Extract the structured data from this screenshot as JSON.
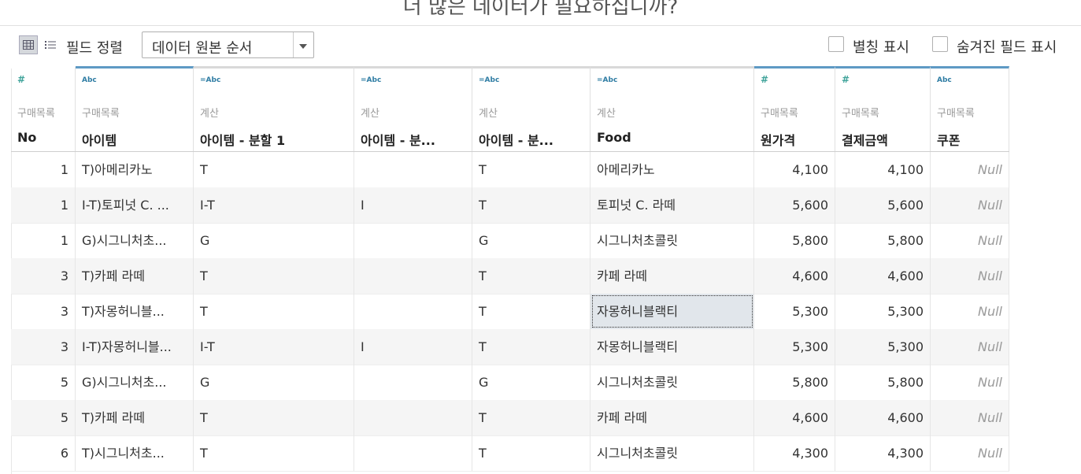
{
  "banner": {
    "text": "더 많은 데이터가 필요하십니까?"
  },
  "toolbar": {
    "grid_view_icon": "grid-icon",
    "list_view_icon": "list-icon",
    "sort_label": "필드 정렬",
    "sort_select": {
      "value": "데이터 원본 순서"
    },
    "show_aliases_label": "별칭 표시",
    "show_hidden_label": "숨겨진 필드 표시"
  },
  "columns": [
    {
      "type_icon": "#",
      "source": "구매목록",
      "name": "No"
    },
    {
      "type_icon": "Abc",
      "source": "구매목록",
      "name": "아이템"
    },
    {
      "type_icon": "=Abc",
      "source": "계산",
      "name": "아이템 - 분할 1"
    },
    {
      "type_icon": "=Abc",
      "source": "계산",
      "name": "아이템 - 분..."
    },
    {
      "type_icon": "=Abc",
      "source": "계산",
      "name": "아이템 - 분..."
    },
    {
      "type_icon": "=Abc",
      "source": "계산",
      "name": "Food"
    },
    {
      "type_icon": "#",
      "source": "구매목록",
      "name": "원가격"
    },
    {
      "type_icon": "#",
      "source": "구매목록",
      "name": "결제금액"
    },
    {
      "type_icon": "Abc",
      "source": "구매목록",
      "name": "쿠폰"
    }
  ],
  "rows": [
    [
      "1",
      "T)아메리카노",
      "T",
      "",
      "T",
      "아메리카노",
      "4,100",
      "4,100",
      "Null"
    ],
    [
      "1",
      "I-T)토피넛 C. ...",
      "I-T",
      "I",
      "T",
      "토피넛 C. 라떼",
      "5,600",
      "5,600",
      "Null"
    ],
    [
      "1",
      "G)시그니처초...",
      "G",
      "",
      "G",
      "시그니처초콜릿",
      "5,800",
      "5,800",
      "Null"
    ],
    [
      "3",
      "T)카페 라떼",
      "T",
      "",
      "T",
      "카페 라떼",
      "4,600",
      "4,600",
      "Null"
    ],
    [
      "3",
      "T)자몽허니블...",
      "T",
      "",
      "T",
      "자몽허니블랙티",
      "5,300",
      "5,300",
      "Null"
    ],
    [
      "3",
      "I-T)자몽허니블...",
      "I-T",
      "I",
      "T",
      "자몽허니블랙티",
      "5,300",
      "5,300",
      "Null"
    ],
    [
      "5",
      "G)시그니처초...",
      "G",
      "",
      "G",
      "시그니처초콜릿",
      "5,800",
      "5,800",
      "Null"
    ],
    [
      "5",
      "T)카페 라떼",
      "T",
      "",
      "T",
      "카페 라떼",
      "4,600",
      "4,600",
      "Null"
    ],
    [
      "6",
      "T)시그니처초...",
      "T",
      "",
      "T",
      "시그니처초콜릿",
      "4,300",
      "4,300",
      "Null"
    ]
  ]
}
